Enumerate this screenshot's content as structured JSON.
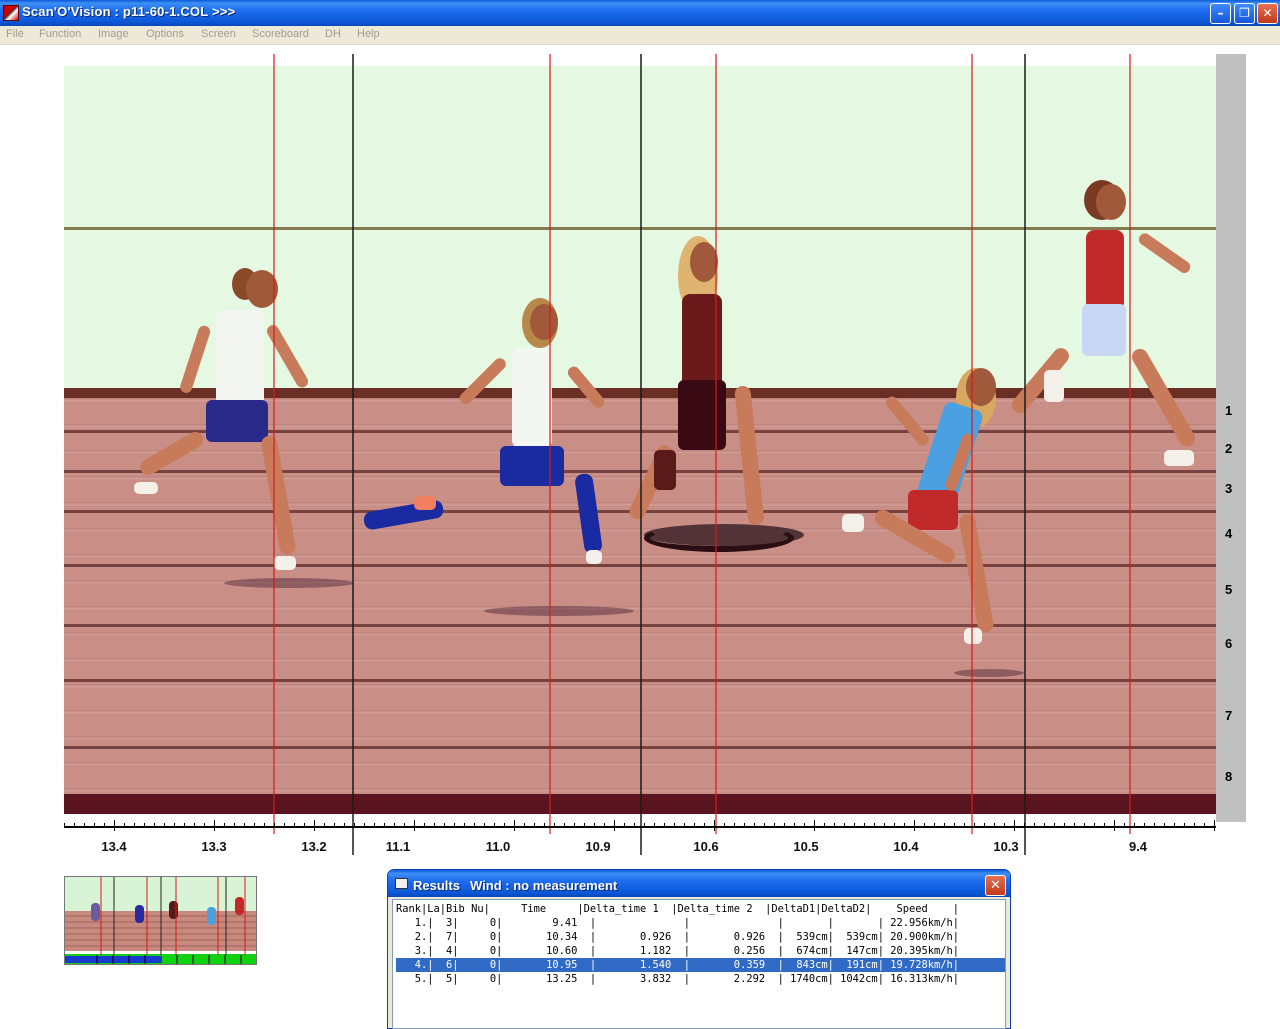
{
  "window": {
    "title": "Scan'O'Vision :   p11-60-1.COL  >>>",
    "minimize_glyph": "–",
    "restore_glyph": "❐",
    "close_glyph": "✕"
  },
  "menu": [
    "File",
    "Function",
    "Image",
    "Options",
    "Screen",
    "Scoreboard",
    "DH",
    "Help"
  ],
  "lanes": [
    "1",
    "2",
    "3",
    "4",
    "5",
    "6",
    "7",
    "8"
  ],
  "time_scale": {
    "labels": [
      "13.4",
      "13.3",
      "13.2",
      "11.1",
      "11.0",
      "10.9",
      "10.6",
      "10.5",
      "10.4",
      "10.3",
      "9.4"
    ]
  },
  "results": {
    "title": "Results",
    "wind": "Wind : no measurement",
    "close_glyph": "✕",
    "header": "Rank|La|Bib Nu|     Time     |Delta_time 1  |Delta_time 2  |DeltaD1|DeltaD2|    Speed    |",
    "rows": [
      "   1.|  3|     0|        9.41  |              |              |       |       | 22.956km/h|",
      "   2.|  7|     0|       10.34  |       0.926  |       0.926  |  539cm|  539cm| 20.900km/h|",
      "   3.|  4|     0|       10.60  |       1.182  |       0.256  |  674cm|  147cm| 20.395km/h|",
      "   4.|  6|     0|       10.95  |       1.540  |       0.359  |  843cm|  191cm| 19.728km/h|",
      "   5.|  5|     0|       13.25  |       3.832  |       2.292  | 1740cm| 1042cm| 16.313km/h|"
    ],
    "selected_row": 3
  },
  "colors": {
    "red_marker": "#d61a1a",
    "black_cut": "#1a1a1a",
    "selection": "#316ac5",
    "titlebar": "#0b57d6"
  }
}
